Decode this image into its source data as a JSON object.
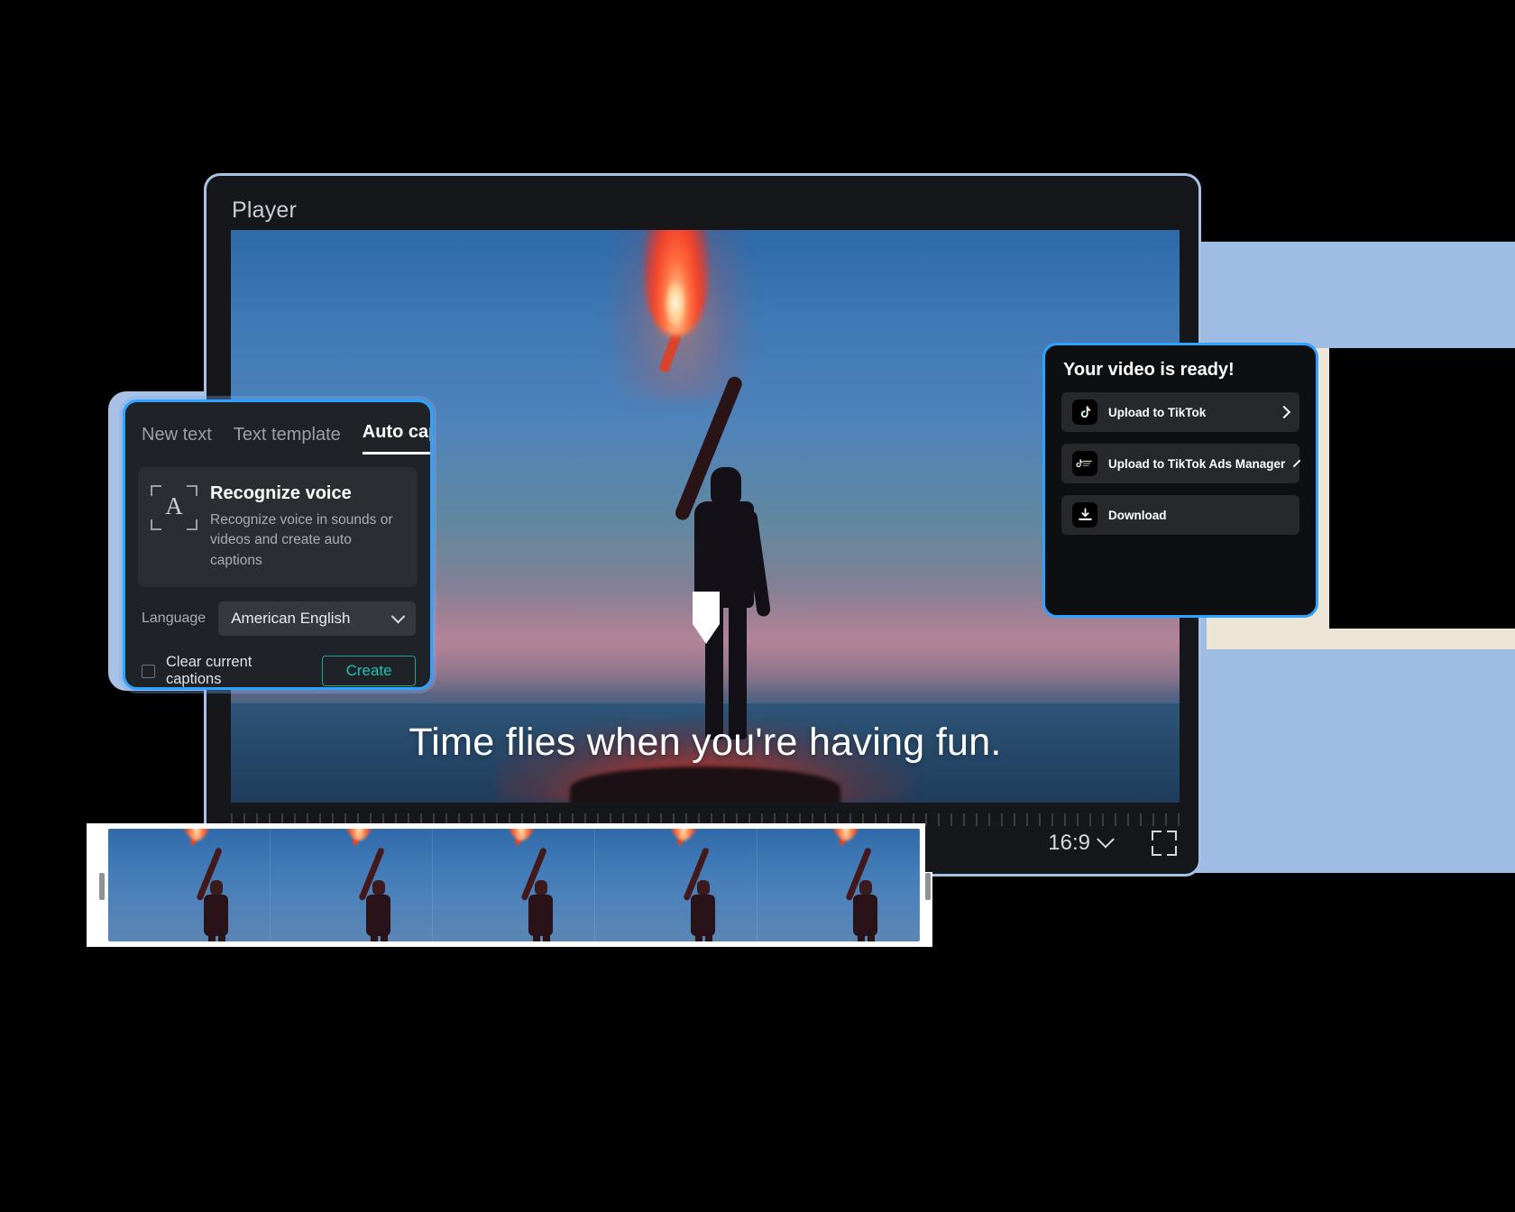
{
  "theme": {
    "accent_blue": "#2ea2ff",
    "panel_bg": "#1f2226",
    "export_panel_bg": "#0e0f11",
    "create_teal": "#1fc2b3",
    "bg_light_blue": "#9fbce4",
    "bg_cream": "#ece5d6"
  },
  "player": {
    "title": "Player",
    "caption_overlay": "Time flies when you're having fun.",
    "aspect_ratio": "16:9",
    "aspect_icon": "chevron-down-icon",
    "fullscreen_icon": "fullscreen-icon"
  },
  "captions_panel": {
    "tabs": [
      {
        "label": "New text",
        "active": false
      },
      {
        "label": "Text template",
        "active": false
      },
      {
        "label": "Auto captions",
        "active": true
      }
    ],
    "collapse_icon": "«",
    "recognize": {
      "icon": "recognize-voice-icon",
      "icon_glyph": "A",
      "title": "Recognize voice",
      "description": "Recognize voice in sounds or videos and create auto captions"
    },
    "language": {
      "label": "Language",
      "value": "American English",
      "chevron": "chevron-down-icon"
    },
    "clear_captions": {
      "label": "Clear current captions",
      "checked": false
    },
    "create_button": "Create"
  },
  "export_panel": {
    "title": "Your video is ready!",
    "options": [
      {
        "label": "Upload to TikTok",
        "icon": "tiktok-icon",
        "chevron": "chevron-right-icon"
      },
      {
        "label": "Upload to TikTok Ads Manager",
        "icon": "tiktok-ads-manager-icon",
        "chevron": "chevron-right-icon"
      },
      {
        "label": "Download",
        "icon": "download-icon",
        "chevron": ""
      }
    ]
  },
  "timeline": {
    "frames_count": 5,
    "playhead_label": "playhead"
  }
}
